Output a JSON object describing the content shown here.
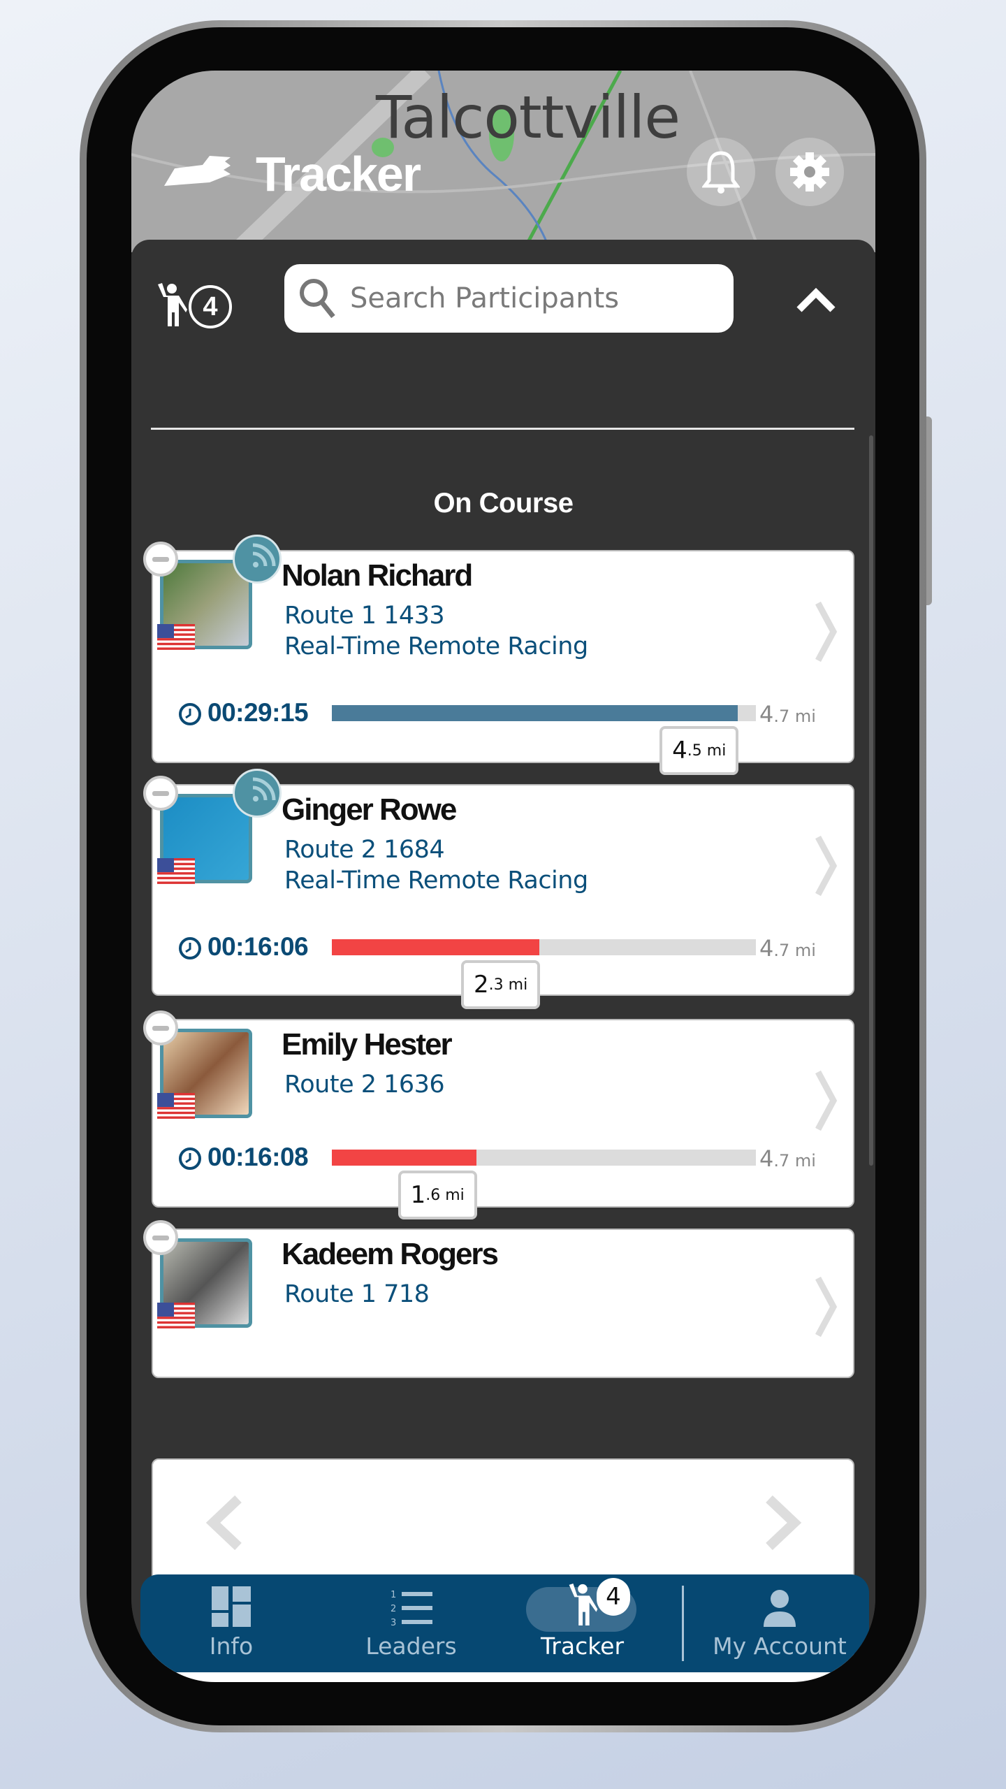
{
  "header": {
    "map_label": "Talcottville",
    "title": "Tracker",
    "icons": [
      "logo-shoe-icon",
      "bell-icon",
      "gear-icon"
    ]
  },
  "toolbar": {
    "tracked_count": "4",
    "search_placeholder": "Search Participants",
    "collapse_icon": "chevron-up-icon"
  },
  "section_title": "On Course",
  "participants": [
    {
      "name": "Nolan Richard",
      "route": "Route 1 1433",
      "event": "Real-Time Remote Racing",
      "time": "00:29:15",
      "progress_mi": 4.5,
      "progress_whole": "4",
      "progress_dec": ".5 mi",
      "total_whole": "4",
      "total_dec": ".7 mi",
      "total_mi": 4.7,
      "bar_color": "#4a7b99",
      "live": true
    },
    {
      "name": "Ginger Rowe",
      "route": "Route 2 1684",
      "event": "Real-Time Remote Racing",
      "time": "00:16:06",
      "progress_mi": 2.3,
      "progress_whole": "2",
      "progress_dec": ".3 mi",
      "total_whole": "4",
      "total_dec": ".7 mi",
      "total_mi": 4.7,
      "bar_color": "#f24444",
      "live": true
    },
    {
      "name": "Emily Hester",
      "route": "Route 2 1636",
      "time": "00:16:08",
      "progress_mi": 1.6,
      "progress_whole": "1",
      "progress_dec": ".6 mi",
      "total_whole": "4",
      "total_dec": ".7 mi",
      "total_mi": 4.7,
      "bar_color": "#f24444",
      "live": false
    },
    {
      "name": "Kadeem Rogers",
      "route": "Route 1 718",
      "live": false
    }
  ],
  "nav": {
    "items": [
      {
        "label": "Info",
        "icon": "dashboard-icon"
      },
      {
        "label": "Leaders",
        "icon": "numbered-list-icon"
      },
      {
        "label": "Tracker",
        "icon": "walker-icon",
        "badge": "4",
        "active": true
      },
      {
        "label": "My Account",
        "icon": "person-icon"
      }
    ]
  },
  "colors": {
    "nav_bg": "#064872",
    "panel_bg": "#333333",
    "accent_teal": "#4f92a3",
    "route_text": "#0b4f7a"
  }
}
